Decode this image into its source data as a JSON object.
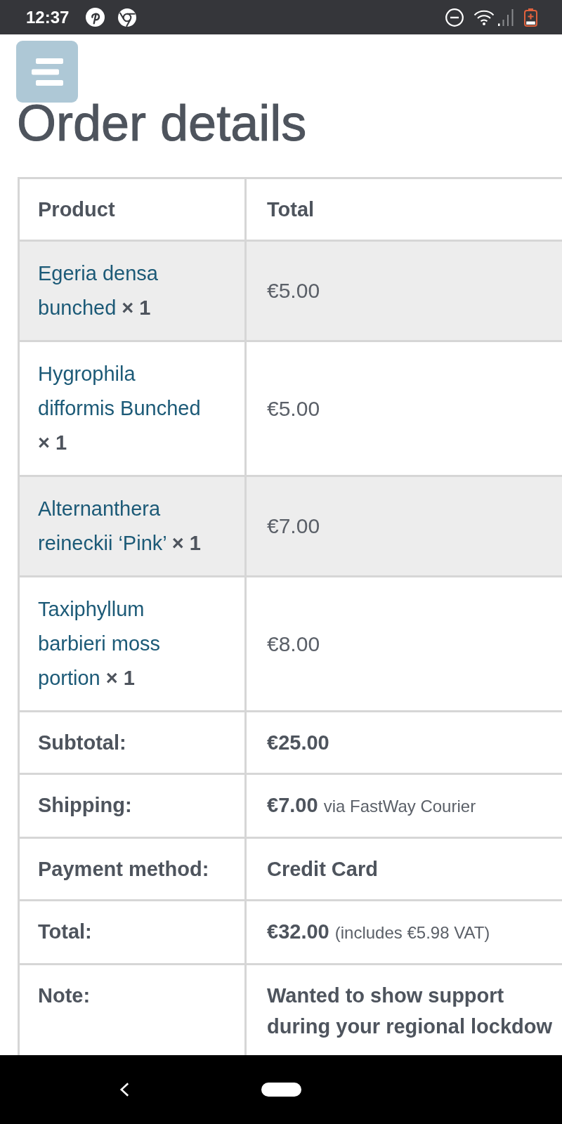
{
  "status_bar": {
    "time": "12:37"
  },
  "title": "Order details",
  "table": {
    "columns": [
      "Product",
      "Total"
    ],
    "items": [
      {
        "name": "Egeria densa bunched **× 1**",
        "total": "€5.00"
      },
      {
        "name": "Hygrophila difformis Bunched **× 1**",
        "total": "€5.00"
      },
      {
        "name": "Alternanthera reineckii ‘Pink’ **× 1**",
        "total": "€7.00"
      },
      {
        "name": "Taxiphyllum barbieri moss portion **× 1**",
        "total": "€8.00"
      }
    ],
    "summary": [
      {
        "label": "Subtotal:",
        "value": "€25.00"
      },
      {
        "label": "Shipping:",
        "value": "€7.00",
        "detail": "via FastWay Courier"
      },
      {
        "label": "Payment method:",
        "value": "Credit Card"
      },
      {
        "label": "Total:",
        "value": "€32.00",
        "detail": "(includes €5.98 VAT)"
      },
      {
        "label": "Note:",
        "value": "Wanted to show support during your regional lockdow"
      }
    ]
  }
}
